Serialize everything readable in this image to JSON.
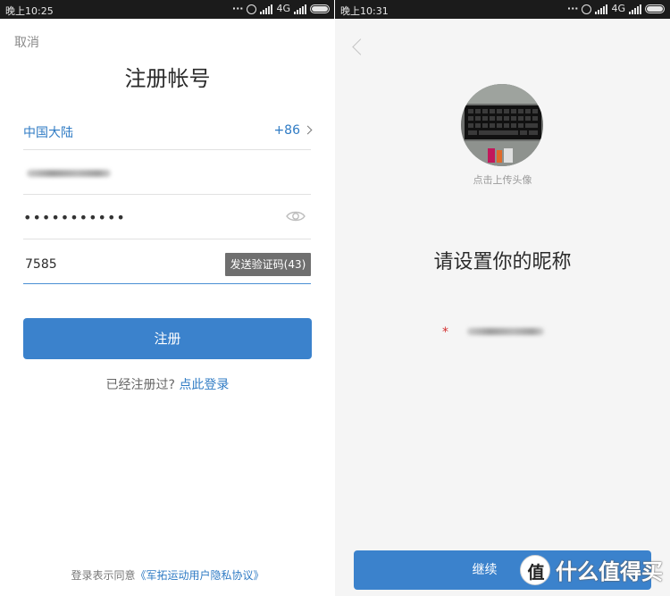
{
  "left_screen": {
    "status_bar": {
      "time": "晚上10:25",
      "network": "4G"
    },
    "cancel_label": "取消",
    "title": "注册帐号",
    "region": {
      "name": "中国大陆",
      "code": "+86"
    },
    "password_mask": "•••••••••••",
    "verification": {
      "value": "7585",
      "send_button": "发送验证码(43)"
    },
    "register_button": "注册",
    "login_prompt": {
      "text": "已经注册过?",
      "link": "点此登录"
    },
    "agreement": {
      "text": "登录表示同意",
      "link": "《军拓运动用户隐私协议》"
    }
  },
  "right_screen": {
    "status_bar": {
      "time": "晚上10:31",
      "network": "4G"
    },
    "upload_hint": "点击上传头像",
    "title": "请设置你的昵称",
    "required_mark": "*",
    "continue_button": "继续"
  },
  "watermark": {
    "logo_char": "值",
    "text": "什么值得买"
  },
  "colors": {
    "accent": "#3b82cc",
    "link": "#2f7bc4",
    "status_bar": "#1b1b1b",
    "send_code_bg": "#6f6f6f",
    "required": "#d32f2f"
  },
  "icons": {
    "status": [
      "dots-icon",
      "alarm-icon",
      "signal-icon",
      "battery-icon"
    ],
    "region_arrow": "chevron-right-icon",
    "password_toggle": "eye-icon",
    "back": "chevron-left-icon"
  }
}
